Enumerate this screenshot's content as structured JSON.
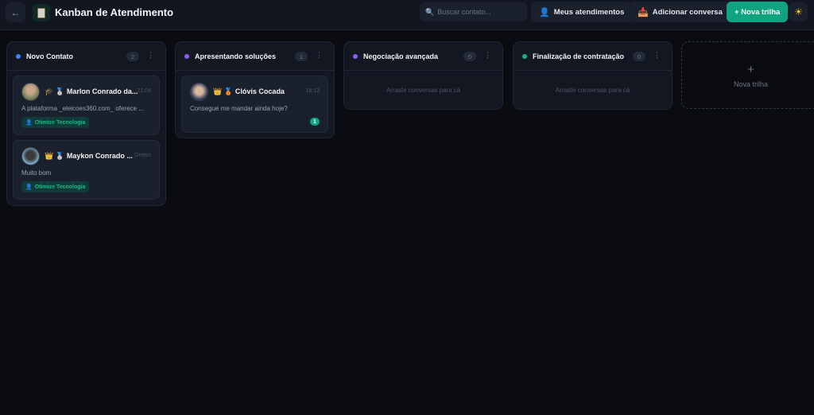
{
  "header": {
    "title": "Kanban de Atendimento",
    "search_placeholder": "Buscar contato...",
    "my_label": "Meus atendimentos",
    "add_label": "Adicionar conversa",
    "new_label": "+ Nova trilha"
  },
  "columns": [
    {
      "title": "Novo Contato",
      "count": "2",
      "color": "#3b82f6",
      "cards": [
        {
          "emojis": "🎓 🥈",
          "name": "Marlon Conrado da...",
          "time": "21:04",
          "message": "A plataforma _eleicoes360.com_ oferece ...",
          "tag": "Otimize Tecnologia"
        },
        {
          "emojis": "👑 🥈",
          "name": "Maykon Conrado ...",
          "time": "Ontem",
          "message": "Muito bom",
          "tag": "Otimize Tecnologia"
        }
      ]
    },
    {
      "title": "Apresentando soluções",
      "count": "1",
      "color": "#8b5cf6",
      "cards": [
        {
          "emojis": "👑 🥉",
          "name": "Clóvis Cocada",
          "time": "18:13",
          "message": "Consegue me mandar ainda hoje?",
          "unread": "1"
        }
      ]
    },
    {
      "title": "Negociação avançada",
      "count": "0",
      "color": "#8b5cf6",
      "empty": "Arraste conversas para cá"
    },
    {
      "title": "Finalização de contratação",
      "count": "0",
      "color": "#10b981",
      "empty": "Arraste conversas para cá"
    }
  ],
  "new_column": {
    "label": "Nova trilha"
  }
}
